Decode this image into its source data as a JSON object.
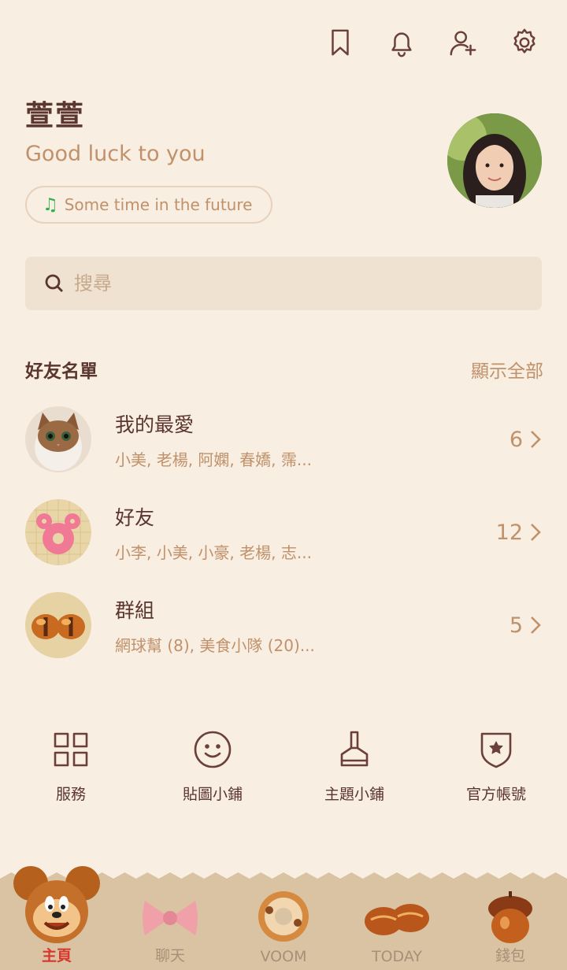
{
  "profile": {
    "name": "萱萱",
    "status": "Good luck to you",
    "music": "Some time in the future"
  },
  "top_icons": [
    "bookmark-icon",
    "bell-icon",
    "add-friend-icon",
    "gear-icon"
  ],
  "search": {
    "placeholder": "搜尋"
  },
  "friends_section": {
    "title": "好友名單",
    "show_all": "顯示全部",
    "rows": [
      {
        "title": "我的最愛",
        "members": "小美, 老楊, 阿嫻, 春嬌, 霈...",
        "count": "6"
      },
      {
        "title": "好友",
        "members": "小李, 小美, 小豪, 老楊, 志...",
        "count": "12"
      },
      {
        "title": "群組",
        "members": "網球幫 (8), 美食小隊 (20)...",
        "count": "5"
      }
    ]
  },
  "services": [
    {
      "label": "服務",
      "icon": "grid-icon"
    },
    {
      "label": "貼圖小鋪",
      "icon": "smiley-icon"
    },
    {
      "label": "主題小鋪",
      "icon": "brush-icon"
    },
    {
      "label": "官方帳號",
      "icon": "shield-star-icon"
    }
  ],
  "tabs": [
    {
      "label": "主頁",
      "icon": "mickey-cookie-icon",
      "active": true
    },
    {
      "label": "聊天",
      "icon": "bow-cookie-icon",
      "active": false
    },
    {
      "label": "VOOM",
      "icon": "donut-icon",
      "active": false
    },
    {
      "label": "TODAY",
      "icon": "peanut-icon",
      "active": false
    },
    {
      "label": "錢包",
      "icon": "acorn-icon",
      "active": false
    }
  ],
  "colors": {
    "background": "#f8eee2",
    "accent_brown": "#5b3530",
    "muted_tan": "#c0916a",
    "active_tab": "#d6362e"
  }
}
